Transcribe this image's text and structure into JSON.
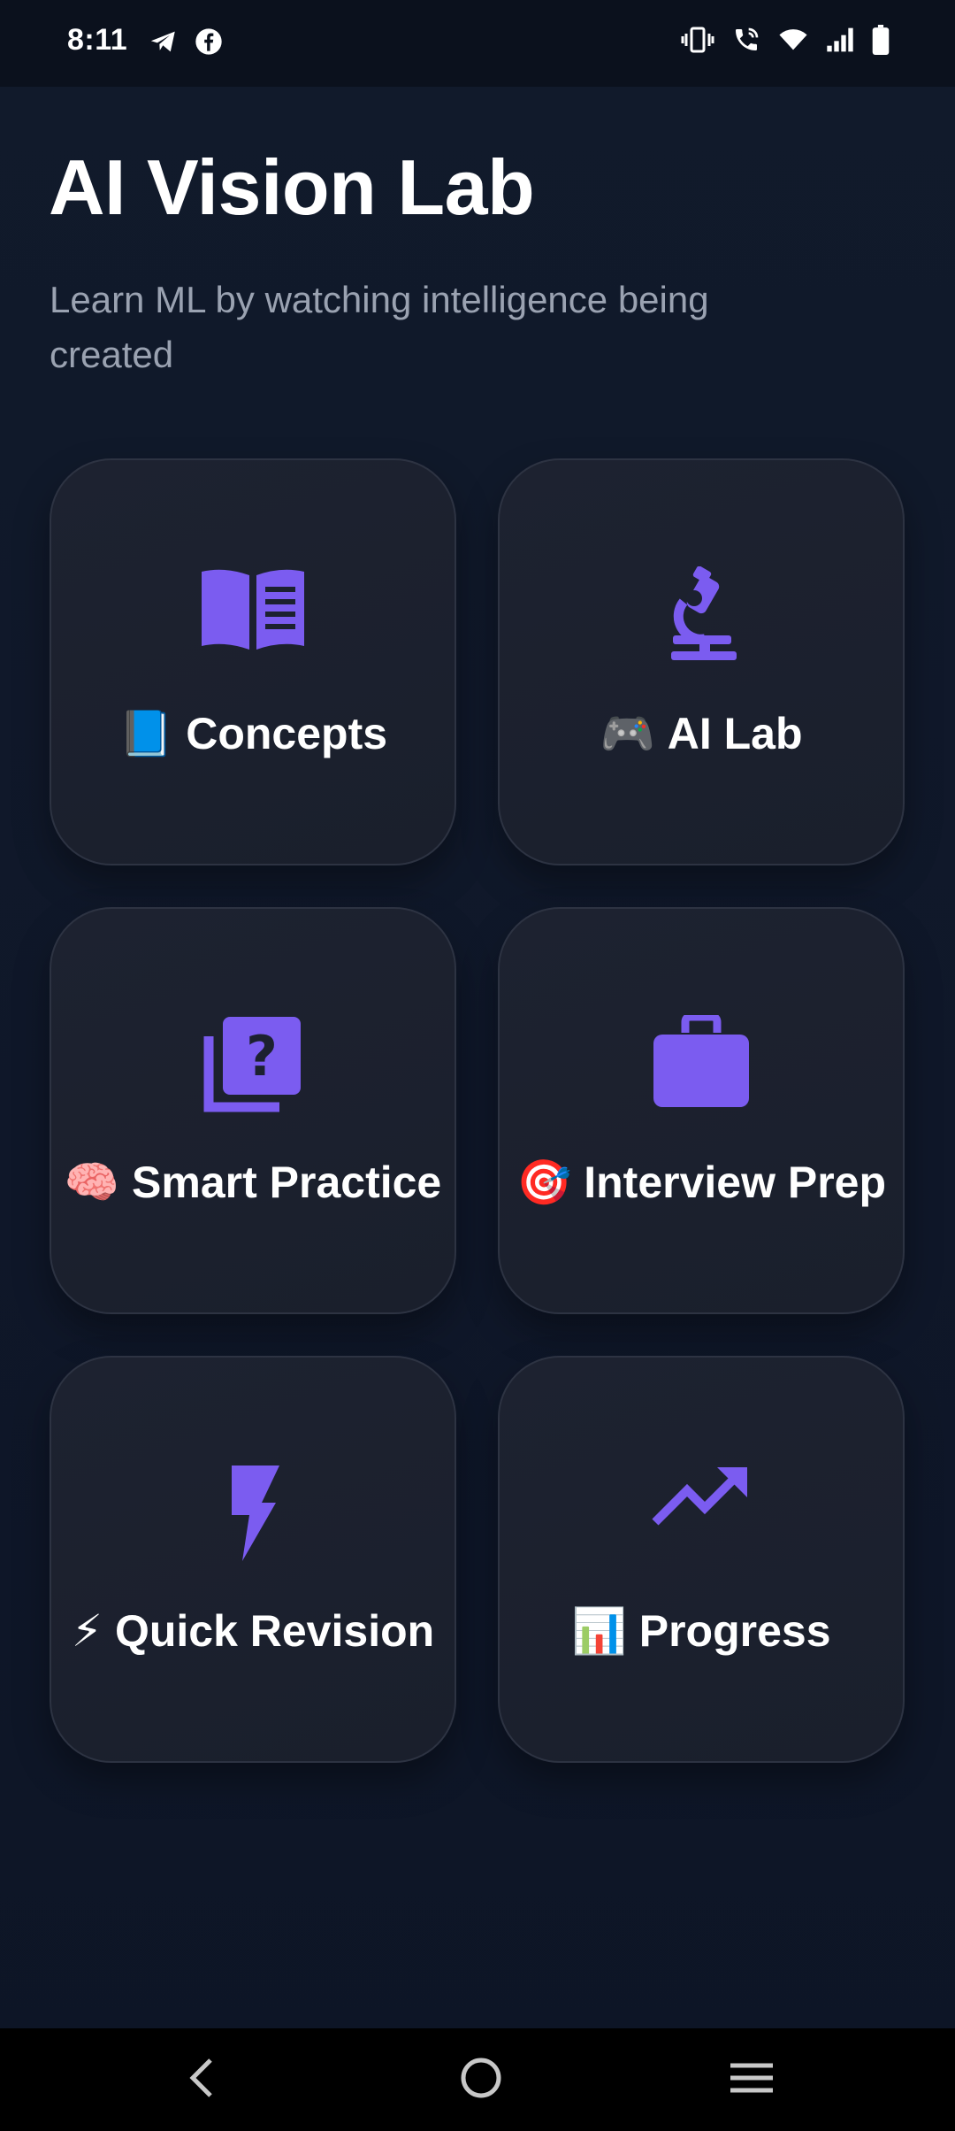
{
  "status_bar": {
    "time": "8:11",
    "left_icons": [
      "telegram-icon",
      "facebook-icon"
    ],
    "right_icons": [
      "vibrate-icon",
      "wifi-calling-icon",
      "wifi-icon",
      "signal-icon",
      "battery-icon"
    ]
  },
  "header": {
    "title": "AI Vision Lab",
    "subtitle": "Learn ML by watching intelligence being created"
  },
  "cards": [
    {
      "icon": "book-icon",
      "emoji": "📘",
      "label": "Concepts"
    },
    {
      "icon": "microscope-icon",
      "emoji": "🎮",
      "label": "AI Lab"
    },
    {
      "icon": "quiz-icon",
      "emoji": "🧠",
      "label": "Smart Practice"
    },
    {
      "icon": "briefcase-icon",
      "emoji": "🎯",
      "label": "Interview Prep"
    },
    {
      "icon": "bolt-icon",
      "emoji": "⚡",
      "label": "Quick Revision"
    },
    {
      "icon": "trending-up-icon",
      "emoji": "📊",
      "label": "Progress"
    }
  ],
  "colors": {
    "accent": "#7b5cf0",
    "background": "#0f1729",
    "card": "#1c2130",
    "text": "#ffffff",
    "subtext": "#9aa2b1"
  },
  "nav": [
    "back-icon",
    "home-icon",
    "recents-icon"
  ]
}
